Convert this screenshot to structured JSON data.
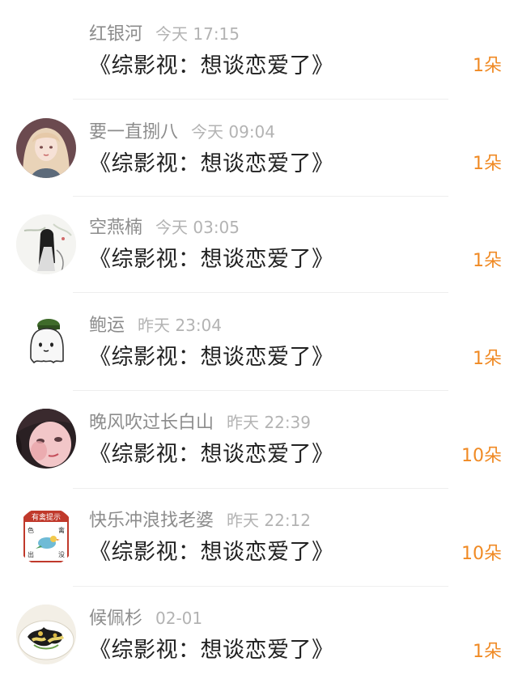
{
  "items": [
    {
      "name": "红银河",
      "time": "今天 17:15",
      "title": "《综影视：想谈恋爱了》",
      "count": "1朵",
      "avatar": "none"
    },
    {
      "name": "要一直捌八",
      "time": "今天 09:04",
      "title": "《综影视：想谈恋爱了》",
      "count": "1朵",
      "avatar": "girl-portrait"
    },
    {
      "name": "空燕楠",
      "time": "今天 03:05",
      "title": "《综影视：想谈恋爱了》",
      "count": "1朵",
      "avatar": "ink-painting"
    },
    {
      "name": "鲍运",
      "time": "昨天 23:04",
      "title": "《综影视：想谈恋爱了》",
      "count": "1朵",
      "avatar": "ghost-with-hat"
    },
    {
      "name": "晚风吹过长白山",
      "time": "昨天 22:39",
      "title": "《综影视：想谈恋爱了》",
      "count": "10朵",
      "avatar": "girl-closeup"
    },
    {
      "name": "快乐冲浪找老婆",
      "time": "昨天 22:12",
      "title": "《综影视：想谈恋爱了》",
      "count": "10朵",
      "avatar": "bird-sign"
    },
    {
      "name": "候佩杉",
      "time": "02-01",
      "title": "《综影视：想谈恋爱了》",
      "count": "1朵",
      "avatar": "food-plate"
    }
  ],
  "sign_text": {
    "top": "有禽提示",
    "left_top": "色",
    "right_top": "禽",
    "left_bottom": "出",
    "right_bottom": "没"
  },
  "colors": {
    "count": "#f08a24",
    "name": "#8c8c8c",
    "time": "#b3b3b3",
    "title": "#222222"
  }
}
